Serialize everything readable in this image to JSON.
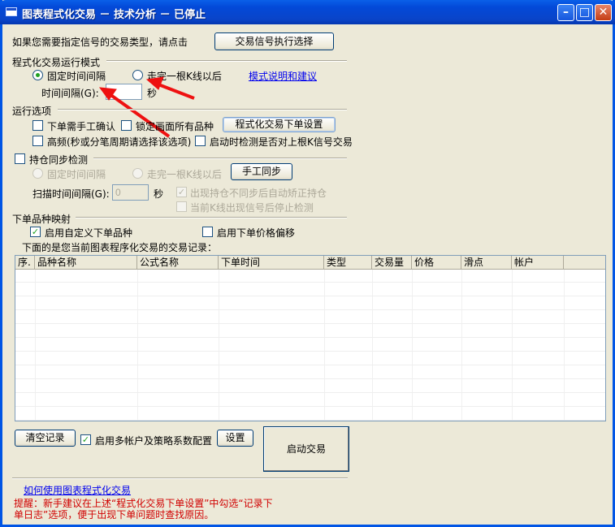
{
  "window": {
    "title": "图表程式化交易 － 技术分析 － 已停止",
    "minimize": "–",
    "maximize": "□",
    "close": "✕"
  },
  "signal": {
    "prompt": "如果您需要指定信号的交易类型，请点击",
    "button": "交易信号执行选择"
  },
  "mode": {
    "heading": "程式化交易运行模式",
    "fixed_interval": "固定时间间隔",
    "after_kline": "走完一根K线以后",
    "help_link": "模式说明和建议",
    "interval_label": "时间间隔(G):",
    "interval_value": "",
    "seconds": "秒"
  },
  "options": {
    "heading": "运行选项",
    "manual_confirm": "下单需手工确认",
    "lock_screen": "锁定画面所有品种",
    "order_settings_button": "程式化交易下单设置",
    "high_freq": "高频(秒或分笔周期请选择该选项)",
    "check_signal": "启动时检测是否对上根K信号交易"
  },
  "position_sync": {
    "heading": "持仓同步检测",
    "fixed_interval": "固定时间间隔",
    "after_kline": "走完一根K线以后",
    "manual_sync": "手工同步",
    "scan_label": "扫描时间间隔(G):",
    "scan_value": "0",
    "seconds": "秒",
    "auto_correct": "出现持仓不同步后自动矫正持仓",
    "stop_check": "当前K线出现信号后停止检测"
  },
  "mapping": {
    "heading": "下单品种映射",
    "custom_product": "启用自定义下单品种",
    "price_offset": "启用下单价格偏移"
  },
  "records": {
    "caption": "下面的是您当前图表程序化交易的交易记录：",
    "columns": [
      "序.",
      "品种名称",
      "公式名称",
      "下单时间",
      "类型",
      "交易量",
      "价格",
      "滑点",
      "帐户"
    ],
    "rows": []
  },
  "bottom": {
    "clear": "清空记录",
    "multi_account": "启用多帐户及策略系数配置",
    "settings": "设置",
    "start": "启动交易",
    "howto_link": "如何使用图表程式化交易",
    "tip": "提醒：新手建议在上述“程式化交易下单设置”中勾选“记录下单日志”选项，便于出现下单问题时查找原因。"
  },
  "colors": {
    "title_bar": "#0a4fd8",
    "background": "#ece9d8",
    "warning": "#d00000",
    "link": "#0000ee",
    "annotation_arrow": "#ee1111"
  }
}
